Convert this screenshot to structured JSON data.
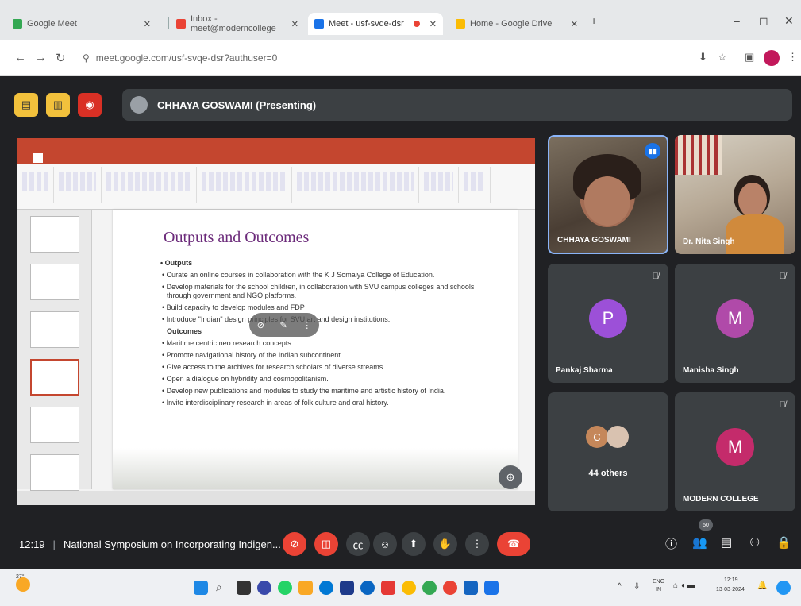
{
  "browser": {
    "tabs": [
      {
        "label": "Google Meet",
        "color": "#34a853",
        "active": false
      },
      {
        "label": "Inbox - meet@moderncollege",
        "color": "#ea4335",
        "active": false
      },
      {
        "label": "Meet - usf-svqe-dsr",
        "color": "#1a73e8",
        "active": true
      },
      {
        "label": "Home - Google Drive",
        "color": "#fbbc04",
        "active": false
      }
    ],
    "new_tab": "+",
    "url": "meet.google.com/usf-svqe-dsr?authuser=0"
  },
  "meet": {
    "presenter_label": "CHHAYA GOSWAMI (Presenting)",
    "time": "12:19",
    "meeting_title": "National Symposium on Incorporating Indigen...",
    "others_badge": "50"
  },
  "slide": {
    "title": "Outputs and Outcomes",
    "outputs_heading": "Outputs",
    "outputs": [
      "Curate an online courses in collaboration with the K J Somaiya College of Education.",
      "Develop materials for the school children, in collaboration with SVU campus colleges and schools through government and NGO platforms.",
      "Build capacity to develop modules and FDP",
      "Introduce \"Indian\" design principles for SVU art and design institutions."
    ],
    "outcomes_heading": "Outcomes",
    "outcomes": [
      "Maritime centric neo research concepts.",
      "Promote navigational history of the Indian subcontinent.",
      "Give access to the archives for research scholars of diverse streams",
      "Open a dialogue on hybridity and cosmopolitanism.",
      "Develop new publications and modules to study the maritime and artistic history of India.",
      "Invite interdisciplinary research in areas of folk culture and oral history."
    ]
  },
  "participants": {
    "chhaya": "CHHAYA GOSWAMI",
    "nita": "Dr. Nita Singh",
    "pankaj": {
      "name": "Pankaj Sharma",
      "initial": "P",
      "color": "#9c50d8"
    },
    "manisha": {
      "name": "Manisha Singh",
      "initial": "M",
      "color": "#b04aa9"
    },
    "others": {
      "label": "44 others",
      "initial": "C",
      "color": "#c5875a"
    },
    "modern": {
      "name": "MODERN COLLEGE",
      "initial": "M",
      "color": "#c42b6b"
    }
  },
  "taskbar": {
    "temperature": "27°",
    "lang_top": "ENG",
    "lang_bottom": "IN",
    "clock_time": "12:19",
    "clock_date": "13-03-2024"
  }
}
